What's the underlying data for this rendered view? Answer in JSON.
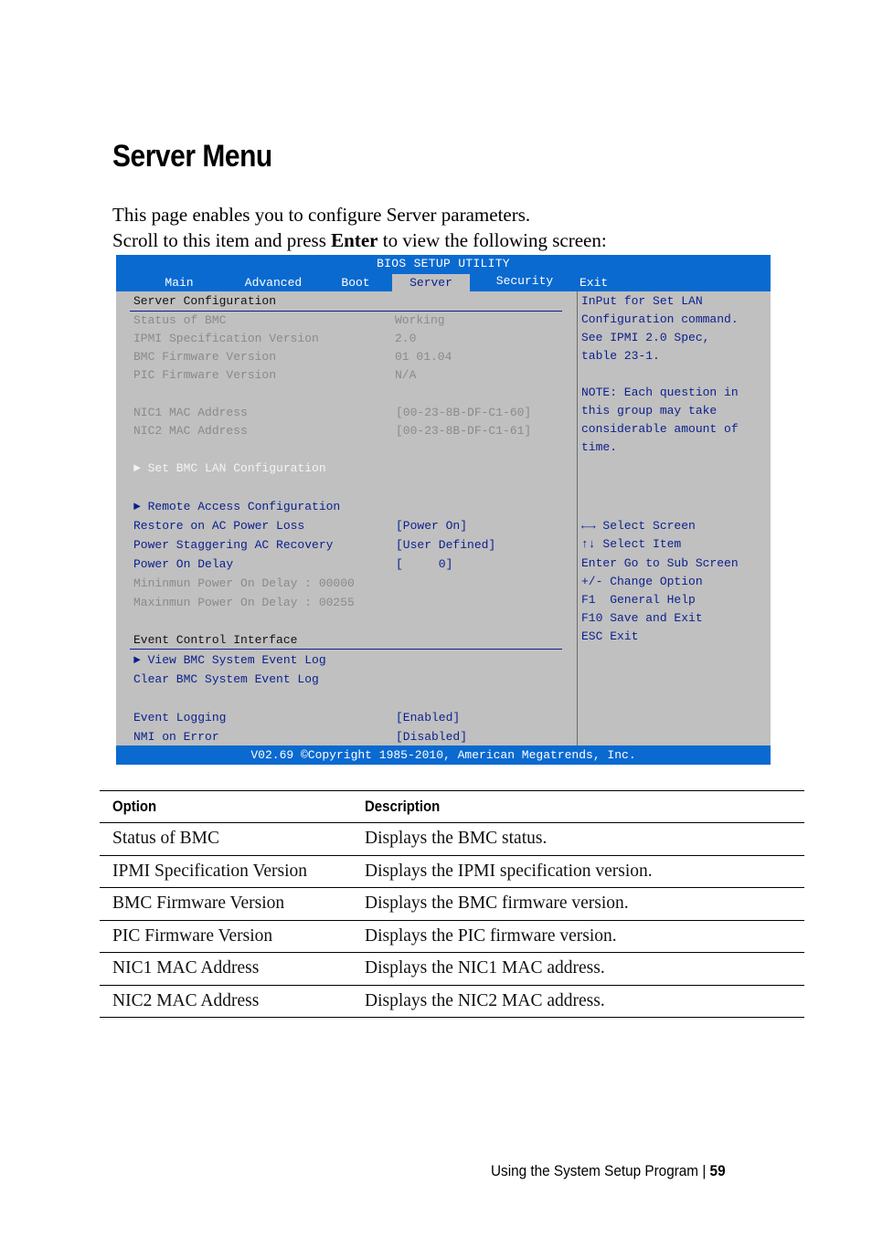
{
  "page": {
    "title": "Server Menu",
    "intro_line1": "This page enables you to configure Server parameters.",
    "intro_line2_pre": "Scroll to this item and press ",
    "intro_line2_key": "Enter",
    "intro_line2_post": " to view the following screen:"
  },
  "bios": {
    "title": "BIOS SETUP UTILITY",
    "tabs": [
      {
        "label": "Main",
        "active": false
      },
      {
        "label": "Advanced",
        "active": false
      },
      {
        "label": "Boot",
        "active": false
      },
      {
        "label": "Server",
        "active": true
      },
      {
        "label": "Security",
        "active": false
      },
      {
        "label": "Exit",
        "active": false
      }
    ],
    "sections": {
      "server_config": "Server Configuration",
      "event_control": "Event Control Interface"
    },
    "info_items": [
      {
        "label": "Status of BMC",
        "value": "Working"
      },
      {
        "label": "IPMI Specification Version",
        "value": "2.0"
      },
      {
        "label": "BMC Firmware Version",
        "value": "01 01.04"
      },
      {
        "label": "PIC Firmware Version",
        "value": "N/A"
      },
      {
        "label": "NIC1 MAC Address",
        "value": "[00-23-8B-DF-C1-60]"
      },
      {
        "label": "NIC2 MAC Address",
        "value": "[00-23-8B-DF-C1-61]"
      }
    ],
    "submenus": {
      "set_bmc_lan": "► Set BMC LAN Configuration",
      "remote_access": "► Remote Access Configuration",
      "view_sel": "► View BMC System Event Log",
      "clear_sel": "Clear BMC System Event Log"
    },
    "settings": [
      {
        "label": "Restore on AC Power Loss",
        "value": "[Power On]"
      },
      {
        "label": "Power Staggering AC Recovery",
        "value": "[User Defined]"
      },
      {
        "label": "Power On Delay",
        "value": "[     0]"
      }
    ],
    "delay_limits": {
      "min": "Mininmun Power On Delay : 00000",
      "max": "Maxinmun Power On Delay : 00255"
    },
    "event_settings": [
      {
        "label": "Event Logging",
        "value": "[Enabled]"
      },
      {
        "label": "NMI on Error",
        "value": "[Disabled]"
      }
    ],
    "help_text": [
      "InPut for Set LAN",
      "Configuration command.",
      "See IPMI 2.0 Spec,",
      "table 23-1.",
      "",
      "NOTE: Each question in",
      "this group may take",
      "considerable amount of",
      "time."
    ],
    "key_help": [
      "←→ Select Screen",
      "↑↓ Select Item",
      "Enter Go to Sub Screen",
      "+/- Change Option",
      "F1  General Help",
      "F10 Save and Exit",
      "ESC Exit"
    ],
    "footer": "V02.69 ©Copyright 1985-2010, American Megatrends, Inc.",
    "colors": {
      "header_blue": "#0a6ad0",
      "panel_gray": "#c0c0c0",
      "text_blue": "#0b1f8c"
    }
  },
  "table": {
    "headers": [
      "Option",
      "Description"
    ],
    "rows": [
      [
        "Status of BMC",
        "Displays the BMC status."
      ],
      [
        "IPMI Specification Version",
        "Displays the IPMI specification version."
      ],
      [
        "BMC Firmware Version",
        "Displays the BMC firmware version."
      ],
      [
        "PIC Firmware Version",
        "Displays the PIC firmware version."
      ],
      [
        "NIC1 MAC Address",
        "Displays the NIC1 MAC address."
      ],
      [
        "NIC2 MAC Address",
        "Displays the NIC2 MAC address."
      ]
    ]
  },
  "footer": {
    "section": "Using the System Setup Program",
    "separator": "|",
    "page_number": "59"
  }
}
